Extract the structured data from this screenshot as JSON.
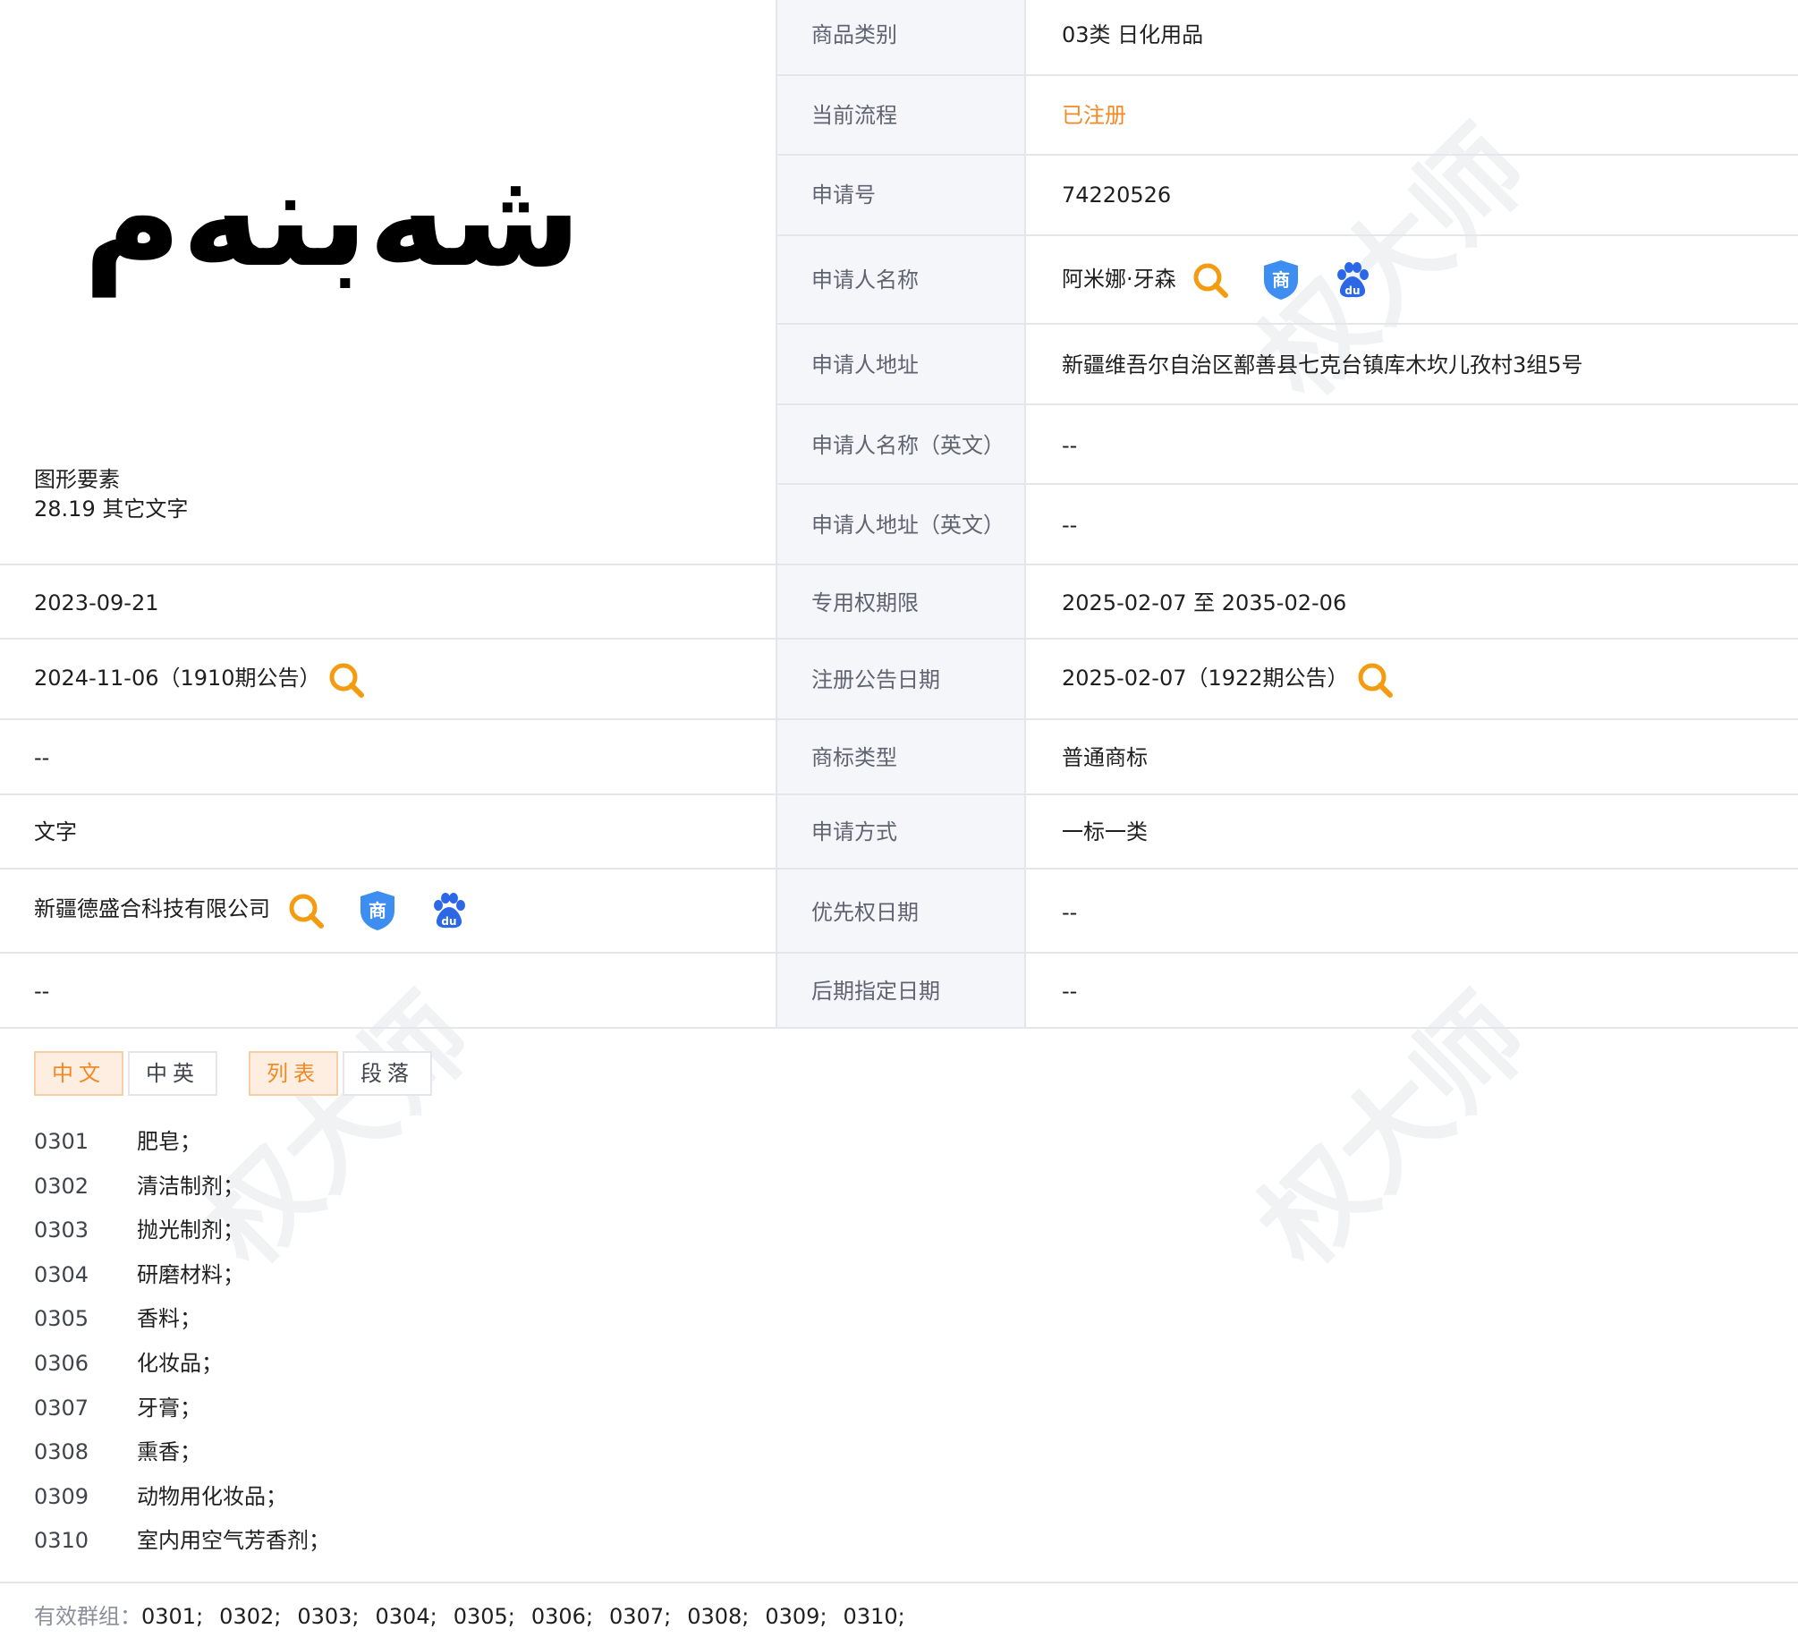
{
  "logo_text": "شەبنەم",
  "figure_elements": {
    "label": "图形要素",
    "code": "28.19 其它文字"
  },
  "left_values": {
    "apply_date": "2023-09-21",
    "prelim_pub": "2024-11-06（1910期公告）",
    "intl_reg_date": "--",
    "mark_form": "文字",
    "agent": "新疆德盛合科技有限公司",
    "remark": "--"
  },
  "details": [
    {
      "label": "商品类别",
      "value": "03类 日化用品"
    },
    {
      "label": "当前流程",
      "value": "已注册"
    },
    {
      "label": "申请号",
      "value": "74220526"
    },
    {
      "label": "申请人名称",
      "value": "阿米娜·牙森"
    },
    {
      "label": "申请人地址",
      "value": "新疆维吾尔自治区鄯善县七克台镇库木坎儿孜村3组5号"
    },
    {
      "label": "申请人名称（英文）",
      "value": "--"
    },
    {
      "label": "申请人地址（英文）",
      "value": "--"
    },
    {
      "label": "专用权期限",
      "value": "2025-02-07 至 2035-02-06"
    },
    {
      "label": "注册公告日期",
      "value": "2025-02-07（1922期公告）"
    },
    {
      "label": "商标类型",
      "value": "普通商标"
    },
    {
      "label": "申请方式",
      "value": "一标一类"
    },
    {
      "label": "优先权日期",
      "value": "--"
    },
    {
      "label": "后期指定日期",
      "value": "--"
    }
  ],
  "colors": {
    "status": "#f08a24",
    "accent": "#f39c12",
    "shield": "#3d8ef0",
    "baidu": "#2b67e6"
  },
  "icons": {
    "search": "search-icon",
    "shield": "trademark-shield-icon",
    "baidu": "baidu-paw-icon"
  },
  "tabs": {
    "lang": [
      {
        "label": "中文",
        "active": true
      },
      {
        "label": "中英",
        "active": false
      }
    ],
    "view": [
      {
        "label": "列表",
        "active": true
      },
      {
        "label": "段落",
        "active": false
      }
    ]
  },
  "goods": [
    {
      "code": "0301",
      "name": "肥皂；"
    },
    {
      "code": "0302",
      "name": "清洁制剂；"
    },
    {
      "code": "0303",
      "name": "抛光制剂；"
    },
    {
      "code": "0304",
      "name": "研磨材料；"
    },
    {
      "code": "0305",
      "name": "香料；"
    },
    {
      "code": "0306",
      "name": "化妆品；"
    },
    {
      "code": "0307",
      "name": "牙膏；"
    },
    {
      "code": "0308",
      "name": "熏香；"
    },
    {
      "code": "0309",
      "name": "动物用化妆品；"
    },
    {
      "code": "0310",
      "name": "室内用空气芳香剂；"
    }
  ],
  "valid_groups": {
    "label": "有效群组：",
    "items": [
      "0301;",
      "0302;",
      "0303;",
      "0304;",
      "0305;",
      "0306;",
      "0307;",
      "0308;",
      "0309;",
      "0310;"
    ]
  },
  "watermark": "权大师"
}
